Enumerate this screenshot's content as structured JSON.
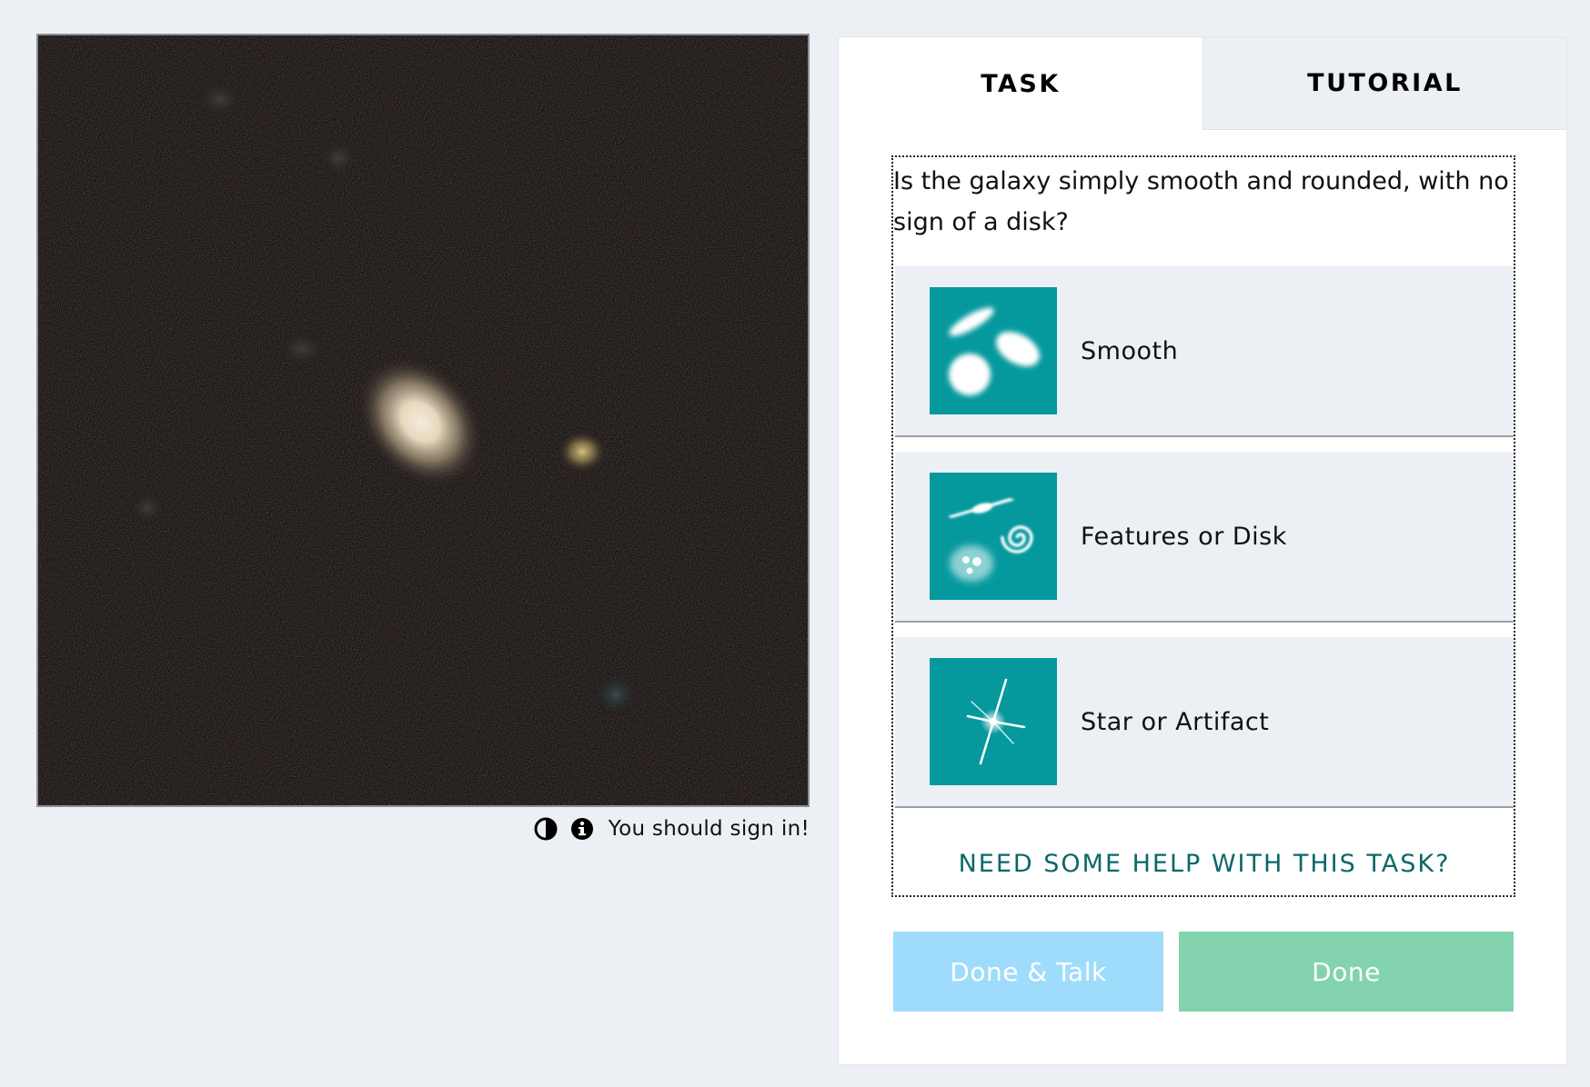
{
  "subject": {
    "image_alt": "",
    "sign_in_text": "You should sign in!",
    "icons": [
      "invert-contrast-icon",
      "info-icon"
    ]
  },
  "tabs": [
    {
      "label": "TASK",
      "active": true
    },
    {
      "label": "TUTORIAL",
      "active": false
    }
  ],
  "task": {
    "question": "Is the galaxy simply smooth and rounded, with no sign of a disk?",
    "answers": [
      {
        "label": "Smooth",
        "icon": "smooth-galaxy-icon"
      },
      {
        "label": "Features or Disk",
        "icon": "features-disk-icon"
      },
      {
        "label": "Star or Artifact",
        "icon": "star-artifact-icon"
      }
    ],
    "help_link": "NEED SOME HELP WITH THIS TASK?"
  },
  "buttons": {
    "done_talk": "Done & Talk",
    "done": "Done"
  },
  "colors": {
    "page_background": "#eceff4",
    "answer_icon_teal": "#05999e",
    "help_link": "#0b6769",
    "done_talk_button": "#9fdcfb",
    "done_button": "#83d3ae"
  }
}
